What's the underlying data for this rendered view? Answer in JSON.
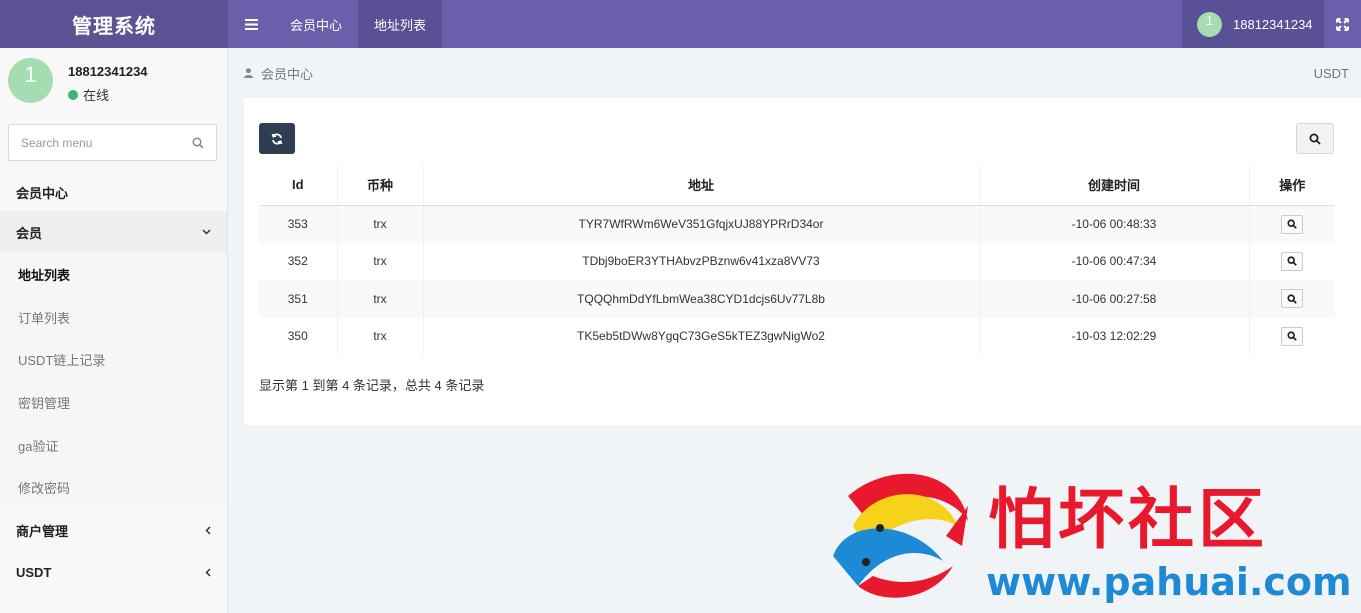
{
  "header": {
    "brand": "管理系统",
    "tabs": [
      {
        "label": "会员中心",
        "active": false
      },
      {
        "label": "地址列表",
        "active": true
      }
    ],
    "user": {
      "avatar_text": "1",
      "name": "18812341234"
    }
  },
  "sidebar": {
    "user": {
      "avatar_text": "1",
      "name": "18812341234",
      "status": "在线"
    },
    "search_placeholder": "Search menu",
    "header": "会员中心",
    "members": {
      "label": "会员",
      "children": [
        "地址列表",
        "订单列表",
        "USDT链上记录",
        "密钥管理",
        "ga验证",
        "修改密码"
      ],
      "active_child": "地址列表"
    },
    "merchant": "商户管理",
    "usdt": "USDT"
  },
  "breadcrumb": {
    "label": "会员中心",
    "right": "USDT"
  },
  "table": {
    "columns": [
      "Id",
      "币种",
      "地址",
      "创建时间",
      "操作"
    ],
    "rows": [
      {
        "id": "353",
        "coin": "trx",
        "address": "TYR7WfRWm6WeV351GfqjxUJ88YPRrD34or",
        "created": "-10-06 00:48:33"
      },
      {
        "id": "352",
        "coin": "trx",
        "address": "TDbj9boER3YTHAbvzPBznw6v41xza8VV73",
        "created": "-10-06 00:47:34"
      },
      {
        "id": "351",
        "coin": "trx",
        "address": "TQQQhmDdYfLbmWea38CYD1dcjs6Uv77L8b",
        "created": "-10-06 00:27:58"
      },
      {
        "id": "350",
        "coin": "trx",
        "address": "TK5eb5tDWw8YgqC73GeS5kTEZ3gwNigWo2",
        "created": "-10-03 12:02:29"
      }
    ],
    "summary": "显示第 1 到第 4 条记录，总共 4 条记录"
  },
  "watermark": {
    "text": "怕坏社区",
    "url": "www.pahuai.com"
  },
  "colors": {
    "topbar": "#6a5fab",
    "brand_bg": "#5d5294",
    "refresh_btn": "#2c3e50",
    "online": "#3cb371"
  }
}
